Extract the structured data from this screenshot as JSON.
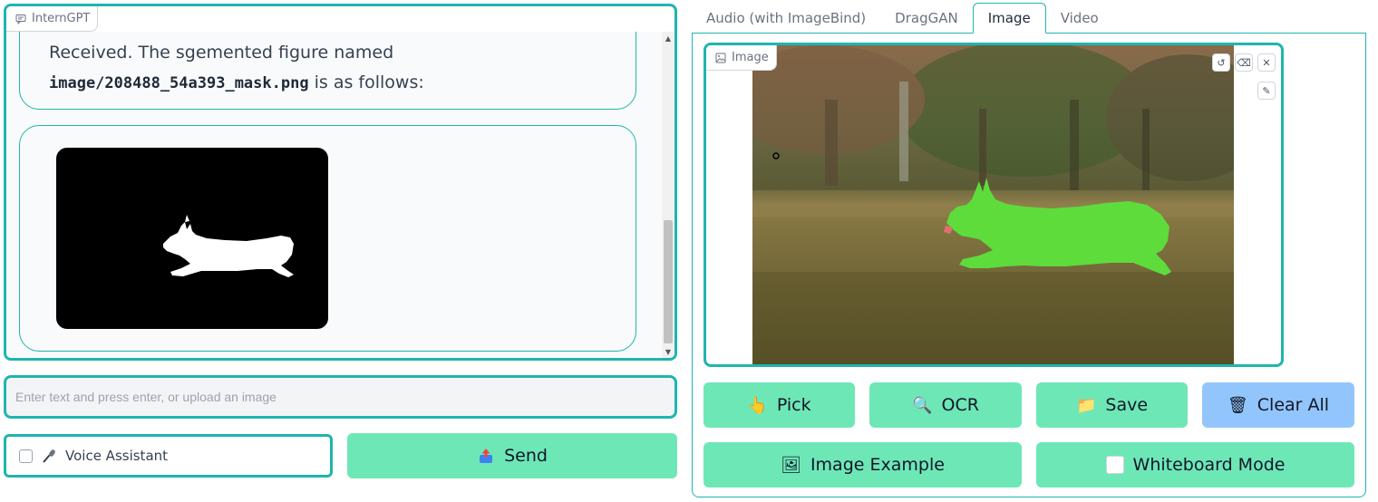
{
  "chat": {
    "panel_label": "InternGPT",
    "message_line1": "Received. The sgemented figure named",
    "message_path": "image/208488_54a393_mask.png",
    "message_suffix": " is as follows:"
  },
  "input": {
    "placeholder": "Enter text and press enter, or upload an image",
    "value": ""
  },
  "voice": {
    "label": "Voice Assistant",
    "checked": false,
    "icon": "microphone-icon"
  },
  "send": {
    "label": "Send",
    "icon": "send-icon"
  },
  "tabs": [
    {
      "label": "Audio (with ImageBind)",
      "active": false
    },
    {
      "label": "DragGAN",
      "active": false
    },
    {
      "label": "Image",
      "active": true
    },
    {
      "label": "Video",
      "active": false
    }
  ],
  "image_panel": {
    "label": "Image",
    "tools": [
      "undo-icon",
      "eraser-icon",
      "close-icon",
      "brush-icon"
    ]
  },
  "buttons": {
    "pick": {
      "label": "Pick",
      "icon": "pointing-hand-icon"
    },
    "ocr": {
      "label": "OCR",
      "icon": "magnifier-icon"
    },
    "save": {
      "label": "Save",
      "icon": "folder-icon"
    },
    "clear_all": {
      "label": "Clear All",
      "icon": "trash-icon"
    },
    "image_example": {
      "label": "Image Example",
      "icon": "picture-icon"
    },
    "whiteboard": {
      "label": "Whiteboard Mode",
      "icon": "whiteboard-icon"
    }
  },
  "colors": {
    "accent": "#1fb5b0",
    "button_green": "#6ee7b7",
    "button_blue": "#93c5fd",
    "mask_overlay": "#5ddc3c"
  }
}
